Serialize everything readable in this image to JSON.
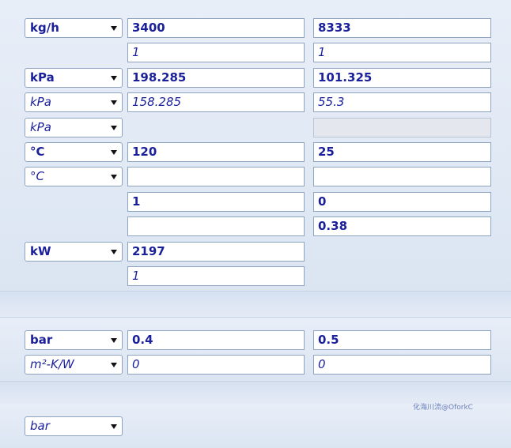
{
  "rows": [
    {
      "unit": "kg/h",
      "v1": "3400",
      "v2": "8333"
    },
    {
      "v1": "1",
      "v2": "1"
    },
    {
      "unit": "kPa",
      "v1": "198.285",
      "v2": "101.325"
    },
    {
      "unit": "kPa",
      "v1": "158.285",
      "v2": "55.3"
    },
    {
      "unit": "kPa",
      "v1": "",
      "v2": ""
    },
    {
      "unit": "°C",
      "v1": "120",
      "v2": "25"
    },
    {
      "unit": "°C",
      "v1": "",
      "v2": ""
    },
    {
      "v1": "1",
      "v2": "0"
    },
    {
      "v1": "",
      "v2": "0.38"
    },
    {
      "unit": "kW",
      "v1": "2197"
    },
    {
      "v1": "1"
    }
  ],
  "section2": [
    {
      "unit": "bar",
      "v1": "0.4",
      "v2": "0.5"
    },
    {
      "unit": "m²-K/W",
      "v1": "0",
      "v2": "0"
    }
  ],
  "section3": [
    {
      "unit": "bar"
    }
  ],
  "watermark": "化海川流@OforkC"
}
